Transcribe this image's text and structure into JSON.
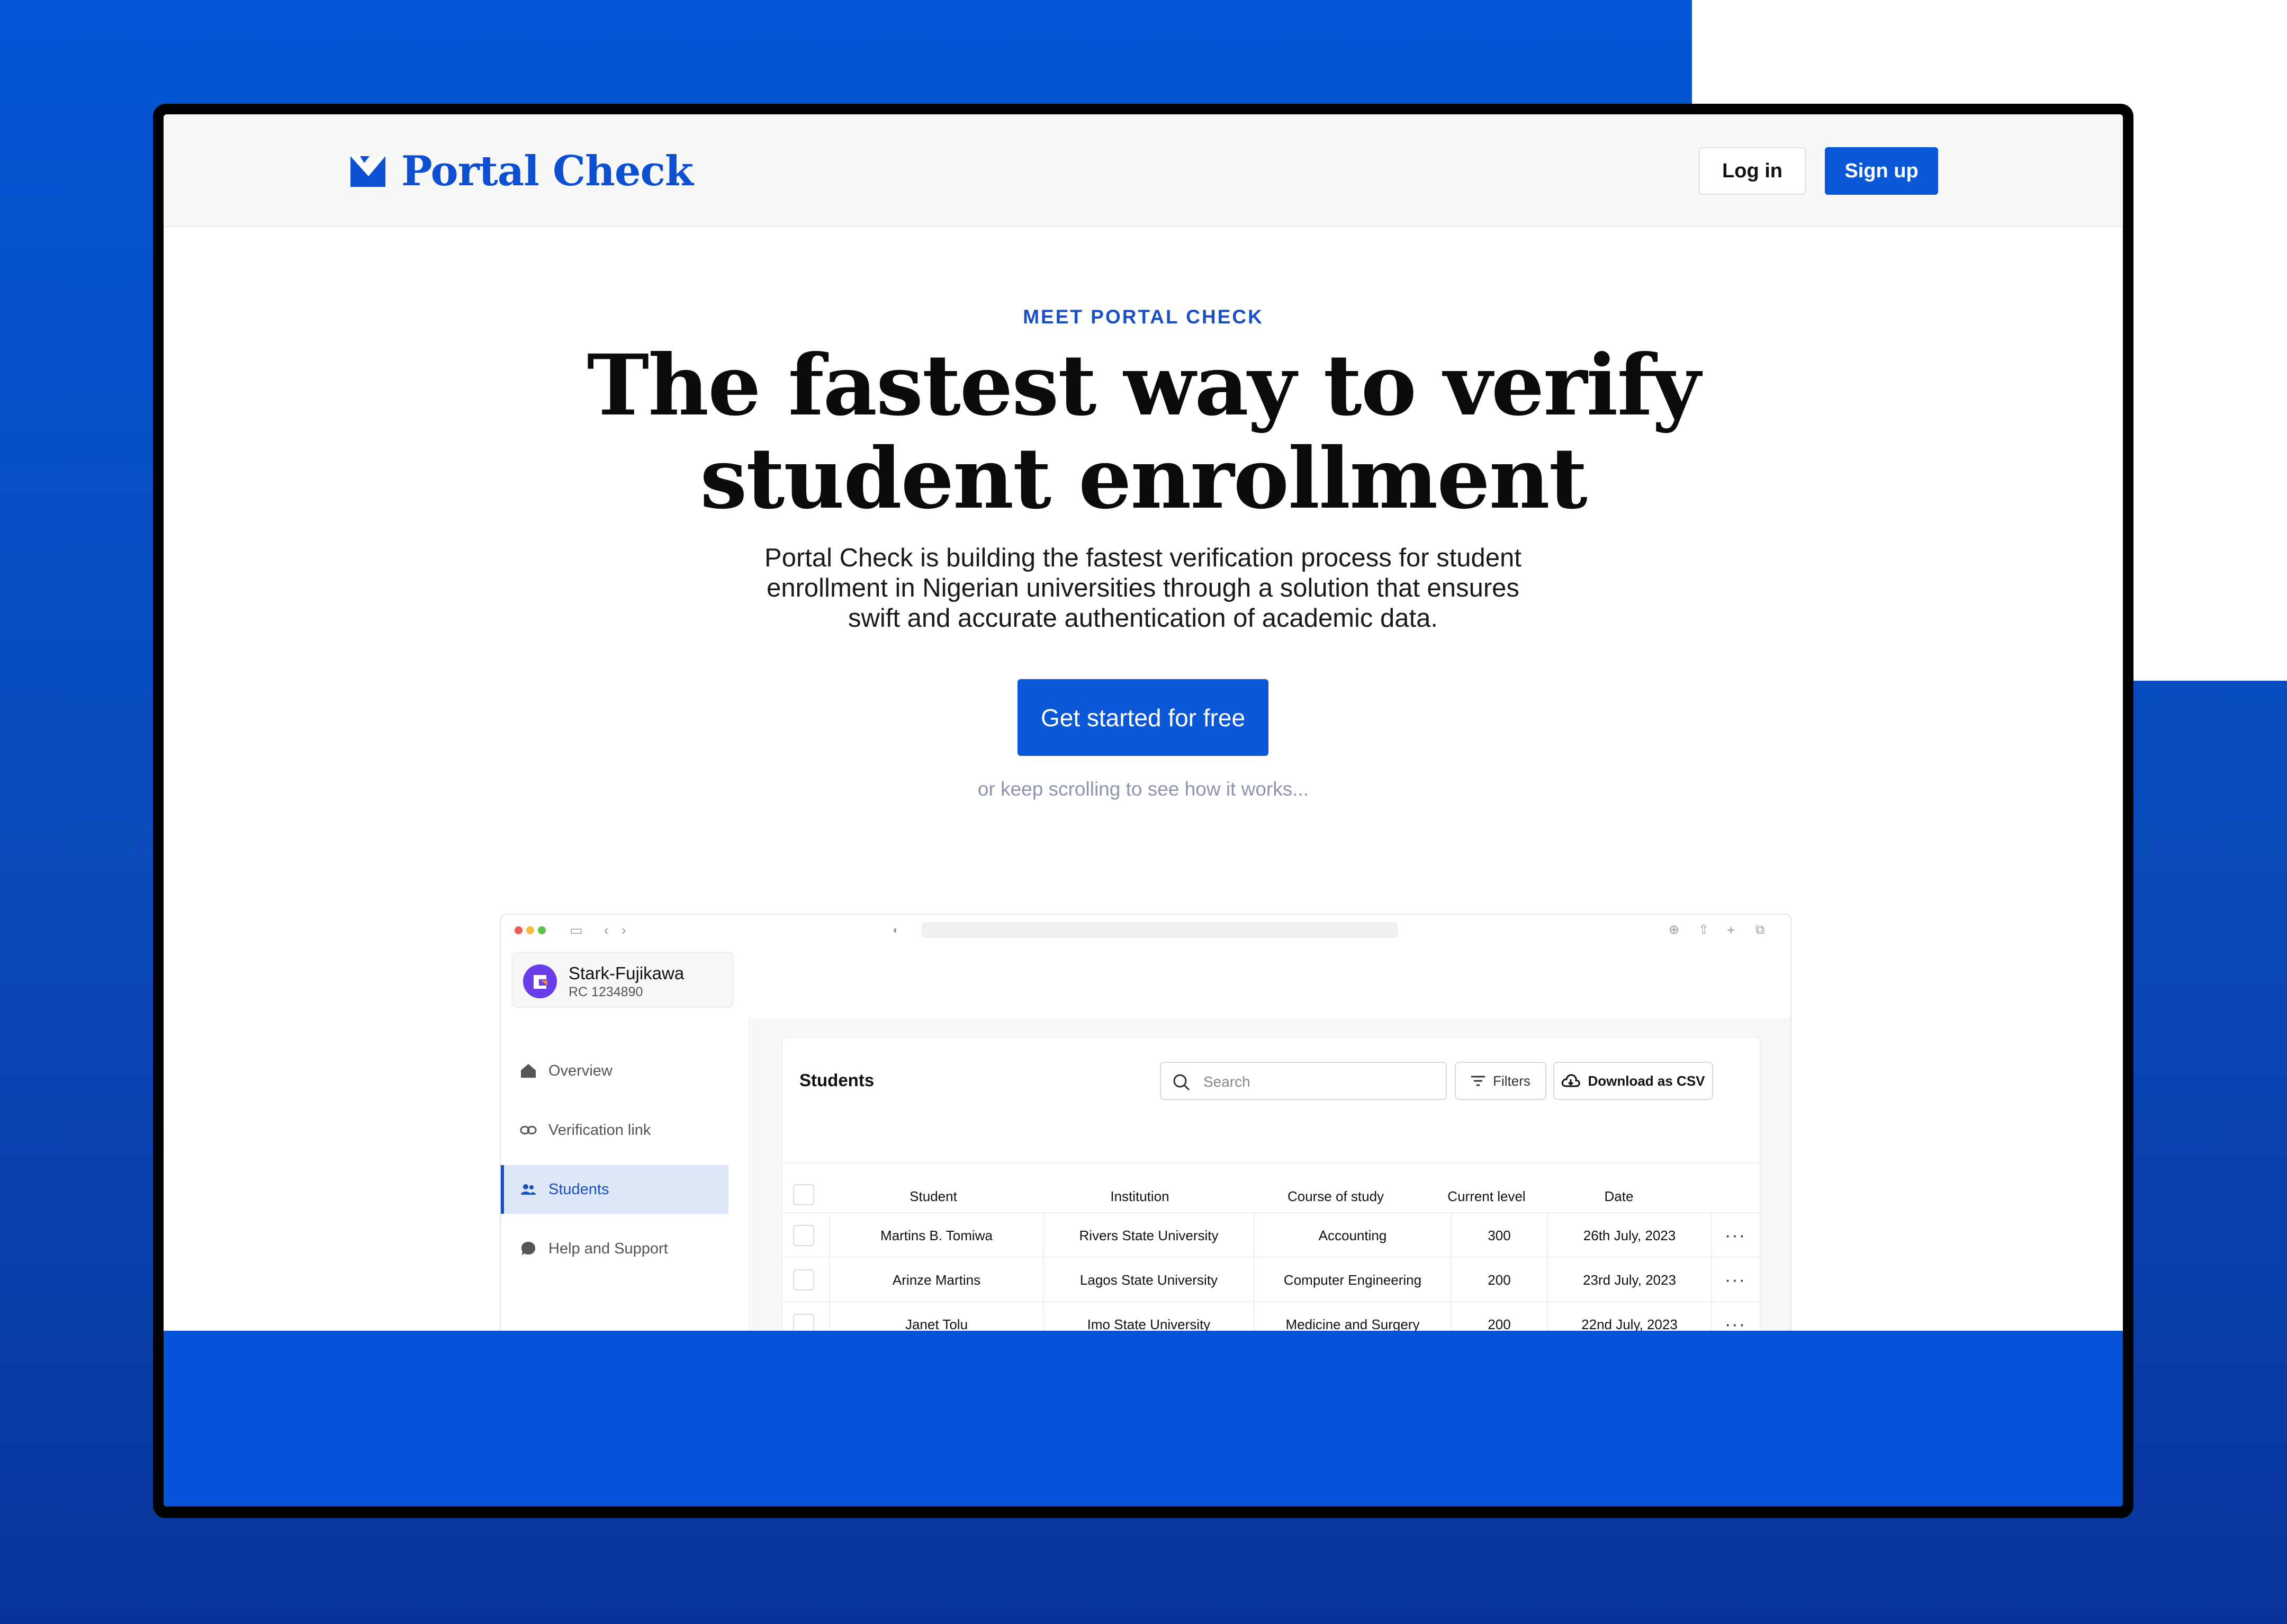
{
  "brand": {
    "name": "Portal Check",
    "accent": "#0d4fd1",
    "logo_icon": "checkmark-logo-icon"
  },
  "nav": {
    "login_label": "Log in",
    "signup_label": "Sign up"
  },
  "hero": {
    "eyebrow": "MEET PORTAL CHECK",
    "headline_line1": "The fastest way to verify",
    "headline_line2": "student enrollment",
    "subtext_line1": "Portal Check is building the fastest verification process for student",
    "subtext_line2": "enrollment in Nigerian universities through a solution that ensures",
    "subtext_line3": "swift and accurate authentication of academic data.",
    "cta_label": "Get started for free",
    "scroll_hint": "or keep scrolling to see how it works..."
  },
  "mock_app": {
    "org": {
      "name": "Stark-Fujikawa",
      "rc": "RC 1234890"
    },
    "sidebar": [
      {
        "label": "Overview",
        "icon": "home-icon"
      },
      {
        "label": "Verification link",
        "icon": "link-icon"
      },
      {
        "label": "Students",
        "icon": "users-icon",
        "active": true
      },
      {
        "label": "Help and Support",
        "icon": "chat-bubble-icon"
      }
    ],
    "panel": {
      "title": "Students",
      "search_placeholder": "Search",
      "filters_label": "Filters",
      "csv_label": "Download as CSV"
    },
    "table": {
      "headers": [
        "Student",
        "Institution",
        "Course of study",
        "Current level",
        "Date"
      ],
      "rows": [
        [
          "Martins B. Tomiwa",
          "Rivers State University",
          "Accounting",
          "300",
          "26th July, 2023"
        ],
        [
          "Arinze Martins",
          "Lagos State University",
          "Computer Engineering",
          "200",
          "23rd July, 2023"
        ],
        [
          "Janet Tolu",
          "Imo State University",
          "Medicine and Surgery",
          "200",
          "22nd July, 2023"
        ]
      ],
      "row_action": "···"
    }
  },
  "colors": {
    "primary": "#0a58d8",
    "background": "#0356d6",
    "active_nav_bg": "#dde7f8"
  }
}
